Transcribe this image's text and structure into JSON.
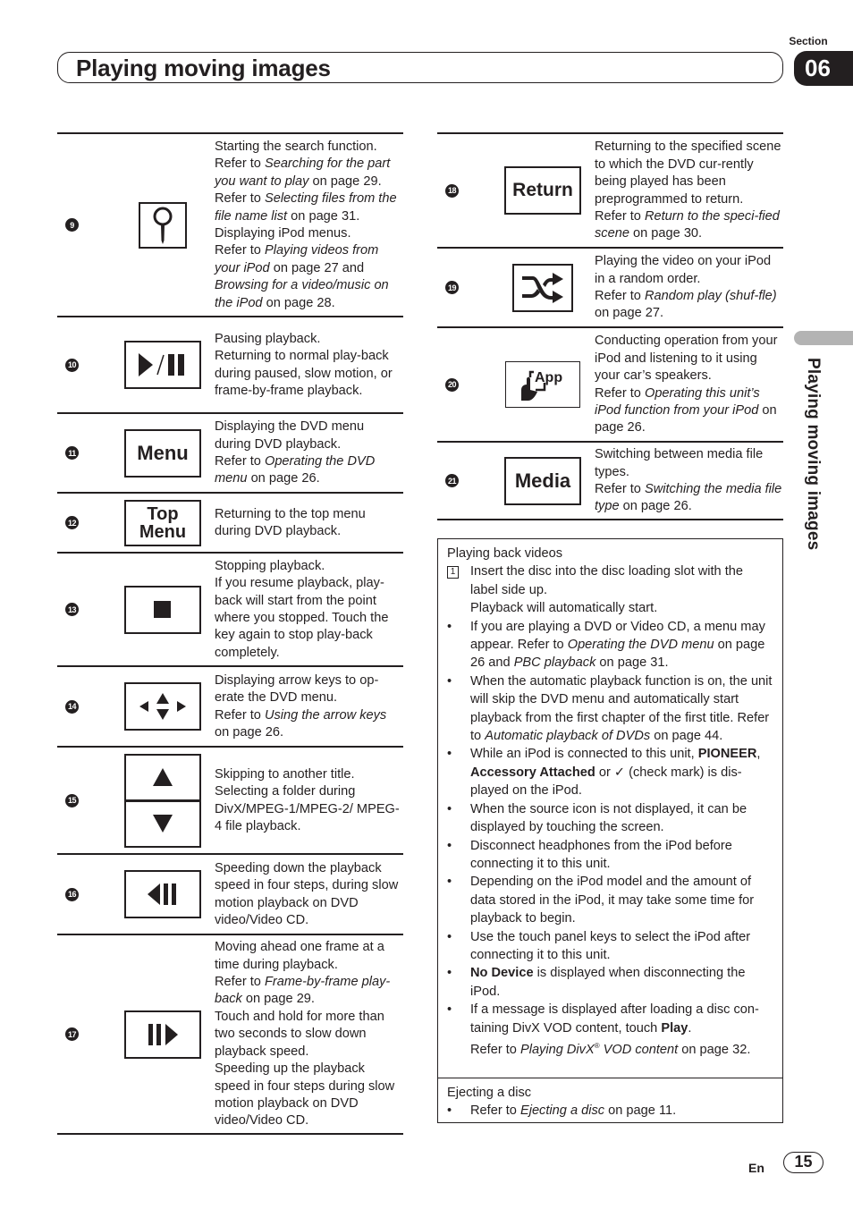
{
  "header": {
    "section_label": "Section",
    "section_number": "06",
    "title": "Playing moving images"
  },
  "side_tab": {
    "label": "Playing moving images"
  },
  "left_keys": [
    {
      "number": "9",
      "icon": "search-icon",
      "desc": [
        {
          "t": "Starting the search function."
        },
        {
          "br": true
        },
        {
          "t": "Refer to "
        },
        {
          "i": "Searching for the part you want to play"
        },
        {
          "t": " on page 29."
        },
        {
          "br": true
        },
        {
          "t": "Refer to "
        },
        {
          "i": "Selecting files from the file name list"
        },
        {
          "t": " on page 31."
        },
        {
          "br": true
        },
        {
          "t": "Displaying iPod menus."
        },
        {
          "br": true
        },
        {
          "t": "Refer to "
        },
        {
          "i": "Playing videos from your iPod"
        },
        {
          "t": " on page 27 and "
        },
        {
          "i": "Browsing for a video/music on the iPod"
        },
        {
          "t": " on page 28."
        }
      ]
    },
    {
      "number": "10",
      "icon": "play-pause-icon",
      "desc": [
        {
          "t": "Pausing playback."
        },
        {
          "br": true
        },
        {
          "t": "Returning to normal play-back during paused, slow motion, or frame-by-frame playback."
        }
      ]
    },
    {
      "number": "11",
      "icon": "menu-key",
      "key_label": "Menu",
      "desc": [
        {
          "t": "Displaying the DVD menu during DVD playback."
        },
        {
          "br": true
        },
        {
          "t": "Refer to "
        },
        {
          "i": "Operating the DVD menu"
        },
        {
          "t": " on page 26."
        }
      ]
    },
    {
      "number": "12",
      "icon": "top-menu-key",
      "key_label_line1": "Top",
      "key_label_line2": "Menu",
      "desc": [
        {
          "t": "Returning to the top menu during DVD playback."
        }
      ]
    },
    {
      "number": "13",
      "icon": "stop-icon",
      "desc": [
        {
          "t": "Stopping playback."
        },
        {
          "br": true
        },
        {
          "t": "If you resume playback, play-back will start from the point where you stopped. Touch the key again to stop play-back completely."
        }
      ]
    },
    {
      "number": "14",
      "icon": "arrow-keys-icon",
      "desc": [
        {
          "t": "Displaying arrow keys to op-erate the DVD menu."
        },
        {
          "br": true
        },
        {
          "t": "Refer to "
        },
        {
          "i": "Using the arrow keys"
        },
        {
          "t": " on page 26."
        }
      ]
    },
    {
      "number": "15",
      "icon": "up-down-keys",
      "desc": [
        {
          "t": "Skipping to another title."
        },
        {
          "br": true
        },
        {
          "t": "Selecting a folder during DivX/MPEG-1/MPEG-2/ MPEG-4 file playback."
        }
      ]
    },
    {
      "number": "16",
      "icon": "slow-reverse-icon",
      "desc": [
        {
          "t": "Speeding down the playback speed in four steps, during slow motion playback on DVD video/Video CD."
        }
      ]
    },
    {
      "number": "17",
      "icon": "frame-advance-icon",
      "desc": [
        {
          "t": "Moving ahead one frame at a time during playback."
        },
        {
          "br": true
        },
        {
          "t": "Refer to "
        },
        {
          "i": "Frame-by-frame play-back"
        },
        {
          "t": " on page 29."
        },
        {
          "br": true
        },
        {
          "t": "Touch and hold for more than two seconds to slow down playback speed."
        },
        {
          "br": true
        },
        {
          "t": "Speeding up the playback speed in four steps during slow motion playback on DVD video/Video CD."
        }
      ]
    }
  ],
  "right_keys": [
    {
      "number": "18",
      "icon": "return-key",
      "key_label": "Return",
      "desc": [
        {
          "t": "Returning to the specified scene to which the DVD cur-rently being played has been preprogrammed to return."
        },
        {
          "br": true
        },
        {
          "t": "Refer to "
        },
        {
          "i": "Return to the speci-fied scene"
        },
        {
          "t": " on page 30."
        }
      ]
    },
    {
      "number": "19",
      "icon": "shuffle-icon",
      "desc": [
        {
          "t": "Playing the video on your iPod in a random order."
        },
        {
          "br": true
        },
        {
          "t": "Refer to "
        },
        {
          "i": "Random play (shuf-fle)"
        },
        {
          "t": " on page 27."
        }
      ]
    },
    {
      "number": "20",
      "icon": "app-mode-icon",
      "icon_text": "App",
      "desc": [
        {
          "t": "Conducting operation from your iPod and listening to it using your car’s speakers."
        },
        {
          "br": true
        },
        {
          "t": "Refer to "
        },
        {
          "i": "Operating this unit’s iPod function from your iPod"
        },
        {
          "t": " on page 26."
        }
      ]
    },
    {
      "number": "21",
      "icon": "media-key",
      "key_label": "Media",
      "desc": [
        {
          "t": "Switching between media file types."
        },
        {
          "br": true
        },
        {
          "t": "Refer to "
        },
        {
          "i": "Switching the media file type"
        },
        {
          "t": " on page 26."
        }
      ]
    }
  ],
  "info_box": {
    "playing": {
      "heading": "Playing back videos",
      "items": [
        {
          "marker": "step",
          "step": "1",
          "parts": [
            {
              "t": "Insert the disc into the disc loading slot with the label side up."
            },
            {
              "br": true
            },
            {
              "t": "Playback will automatically start."
            }
          ]
        },
        {
          "marker": "bullet",
          "parts": [
            {
              "t": "If you are playing a DVD or Video CD, a menu may appear. Refer to "
            },
            {
              "i": "Operating the DVD menu"
            },
            {
              "t": " on page 26 and "
            },
            {
              "i": "PBC playback"
            },
            {
              "t": " on page 31."
            }
          ]
        },
        {
          "marker": "bullet",
          "parts": [
            {
              "t": "When the automatic playback function is on, the unit will skip the DVD menu and automatically start playback from the first chapter of the first title. Refer to "
            },
            {
              "i": "Automatic playback of DVDs"
            },
            {
              "t": " on page 44."
            }
          ]
        },
        {
          "marker": "bullet",
          "parts": [
            {
              "t": "While an iPod is connected to this unit, "
            },
            {
              "b": "PIONEER"
            },
            {
              "t": ", "
            },
            {
              "b": "Accessory Attached"
            },
            {
              "t": " or ✓ (check mark) is dis-played on the iPod."
            }
          ]
        },
        {
          "marker": "bullet",
          "parts": [
            {
              "t": "When the source icon is not displayed, it can be displayed by touching the screen."
            }
          ]
        },
        {
          "marker": "bullet",
          "parts": [
            {
              "t": "Disconnect headphones from the iPod before connecting it to this unit."
            }
          ]
        },
        {
          "marker": "bullet",
          "parts": [
            {
              "t": "Depending on the iPod model and the amount of data stored in the iPod, it may take some time for playback to begin."
            }
          ]
        },
        {
          "marker": "bullet",
          "parts": [
            {
              "t": "Use the touch panel keys to select the iPod after connecting it to this unit."
            }
          ]
        },
        {
          "marker": "bullet",
          "parts": [
            {
              "b": "No Device"
            },
            {
              "t": " is displayed when disconnecting the iPod."
            }
          ]
        },
        {
          "marker": "bullet",
          "parts": [
            {
              "t": "If a message is displayed after loading a disc con-taining DivX VOD content, touch "
            },
            {
              "b": "Play"
            },
            {
              "t": "."
            },
            {
              "br": true
            },
            {
              "t": "Refer to "
            },
            {
              "i": "Playing DivX"
            },
            {
              "sup": "®"
            },
            {
              "i": " VOD content"
            },
            {
              "t": " on page 32."
            }
          ]
        }
      ]
    },
    "ejecting": {
      "heading": "Ejecting a disc",
      "items": [
        {
          "marker": "bullet",
          "parts": [
            {
              "t": "Refer to "
            },
            {
              "i": "Ejecting a disc"
            },
            {
              "t": " on page 11."
            }
          ]
        }
      ]
    }
  },
  "footer": {
    "language": "En",
    "page_number": "15"
  },
  "bullet_char": "•"
}
